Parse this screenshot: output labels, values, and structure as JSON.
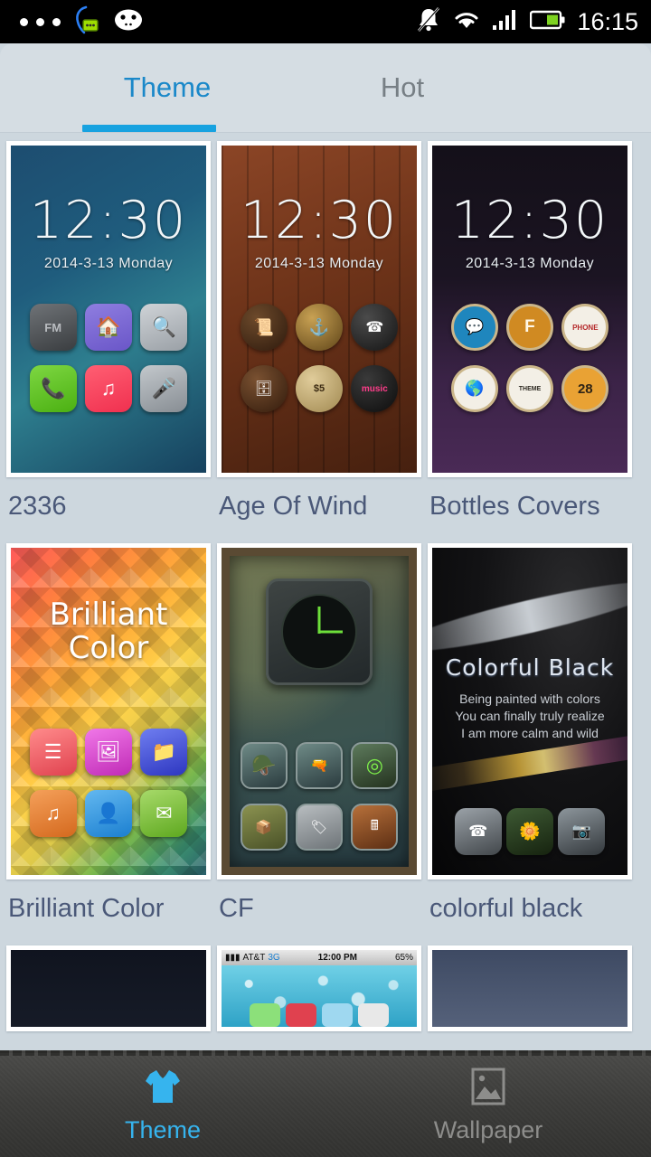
{
  "status_bar": {
    "icons_left": [
      "more-dots-icon",
      "message-notification-icon",
      "android-face-icon"
    ],
    "icons_right": [
      "mute-bell-icon",
      "wifi-icon",
      "signal-bars-icon",
      "battery-icon"
    ],
    "time": "16:15"
  },
  "header": {
    "tabs": [
      {
        "label": "Theme",
        "active": true
      },
      {
        "label": "Hot",
        "active": false
      }
    ],
    "active_color": "#1a88c9",
    "inactive_color": "#777f85",
    "underline_color": "#17a2e0"
  },
  "grid": {
    "rows": [
      {
        "items": [
          {
            "title": "2336",
            "clock": "12:30",
            "date": "2014-3-13  Monday",
            "icons": [
              "fm-radio-icon",
              "home-icon",
              "browser-icon",
              "phone-icon",
              "music-icon",
              "voice-recorder-icon"
            ]
          },
          {
            "title": "Age Of Wind",
            "clock": "12:30",
            "date": "2014-3-13  Monday",
            "icons": [
              "scroll-note-icon",
              "anchor-icon",
              "rotary-phone-icon",
              "drawer-icon",
              "wanted-poster-icon",
              "vinyl-music-icon"
            ]
          },
          {
            "title": "Bottles Covers",
            "clock": "12:30",
            "date": "2014-3-13  Monday",
            "icons": [
              "chat-bottlecap-icon",
              "facebook-bottlecap-icon",
              "phone-bottlecap-icon",
              "globe-bottlecap-icon",
              "theme-bottlecap-icon",
              "calendar-28-bottlecap-icon"
            ]
          }
        ]
      },
      {
        "items": [
          {
            "title": "Brilliant Color",
            "headline": "Brilliant\nColor",
            "icons": [
              "notes-icon",
              "gallery-icon",
              "folder-icon",
              "music-icon",
              "contacts-icon",
              "mail-icon"
            ]
          },
          {
            "title": "CF",
            "widget": "tactical-watch-widget",
            "icons": [
              "helmet-icon",
              "pistol-icon",
              "radar-icon",
              "ammo-crate-icon",
              "dogtag-icon",
              "calculator-icon"
            ]
          },
          {
            "title": "colorful black",
            "headline": "Colorful  Black",
            "tagline": "Being painted with colors\nYou can finally truly realize\nI am more calm and wild",
            "icons": [
              "desk-phone-icon",
              "flower-gallery-icon",
              "camera-icon"
            ]
          }
        ]
      },
      {
        "partial": true,
        "items": [
          {
            "title": "",
            "style": "dark-navy"
          },
          {
            "title": "",
            "style": "ios-waterdrops",
            "ios_carrier": "AT&T",
            "ios_network": "3G",
            "ios_time": "12:00 PM",
            "ios_battery": "65%"
          },
          {
            "title": "",
            "style": "blue-gray-gradient"
          }
        ]
      }
    ]
  },
  "bottom_nav": {
    "items": [
      {
        "label": "Theme",
        "icon": "tshirt-icon",
        "active": true
      },
      {
        "label": "Wallpaper",
        "icon": "picture-icon",
        "active": false
      }
    ],
    "active_color": "#36b4ee",
    "inactive_color": "#8d8d8b"
  }
}
